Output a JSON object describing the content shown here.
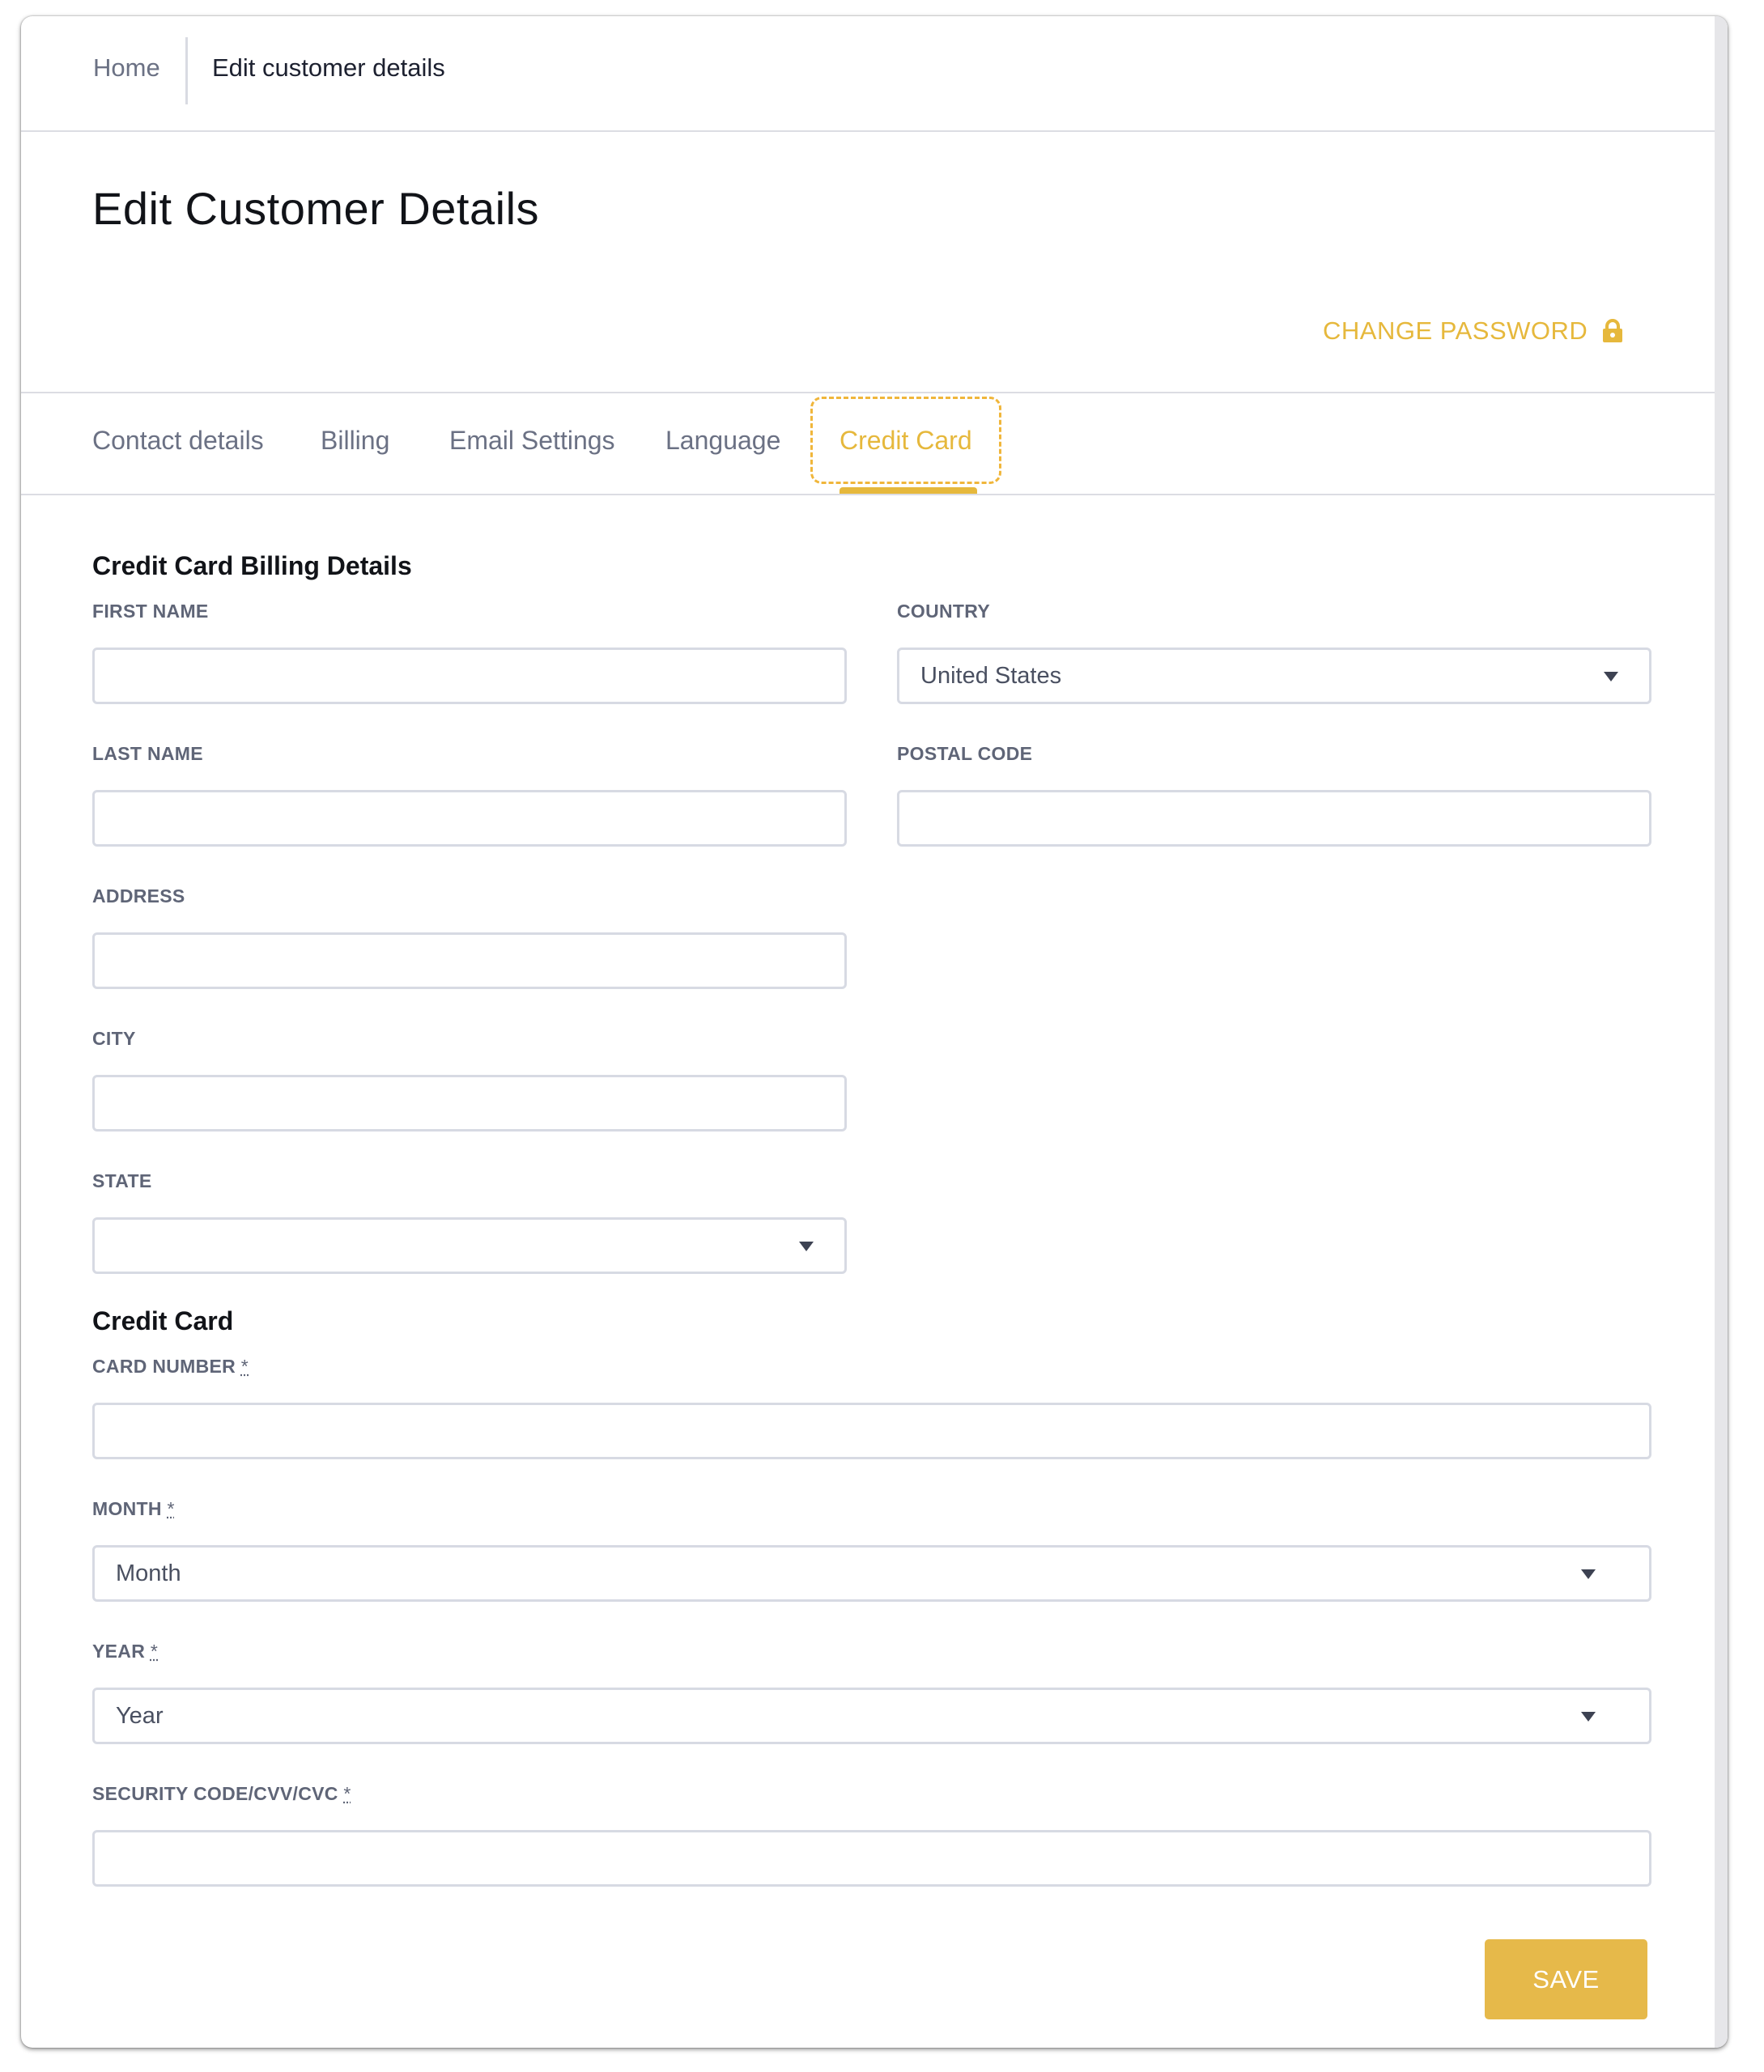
{
  "breadcrumb": {
    "home": "Home",
    "current": "Edit customer details"
  },
  "page": {
    "title": "Edit Customer Details",
    "change_password": "CHANGE PASSWORD"
  },
  "tabs": [
    {
      "label": "Contact details"
    },
    {
      "label": "Billing"
    },
    {
      "label": "Email Settings"
    },
    {
      "label": "Language"
    },
    {
      "label": "Credit Card",
      "active": true
    }
  ],
  "billing_section": {
    "title": "Credit Card Billing Details",
    "first_name_label": "FIRST NAME",
    "first_name_value": "",
    "last_name_label": "LAST NAME",
    "last_name_value": "",
    "address_label": "ADDRESS",
    "address_value": "",
    "city_label": "CITY",
    "city_value": "",
    "state_label": "STATE",
    "state_value": "",
    "country_label": "COUNTRY",
    "country_value": "United States",
    "postal_code_label": "POSTAL CODE",
    "postal_code_value": ""
  },
  "card_section": {
    "title": "Credit Card",
    "card_number_label": "CARD NUMBER",
    "card_number_value": "",
    "month_label": "MONTH",
    "month_value": "Month",
    "year_label": "YEAR",
    "year_value": "Year",
    "cvv_label": "SECURITY CODE/CVV/CVC",
    "cvv_value": "",
    "required_marker": "*"
  },
  "actions": {
    "save": "SAVE"
  },
  "icons": {
    "lock": "lock-icon",
    "caret": "chevron-down-icon"
  },
  "colors": {
    "accent": "#e6b83c",
    "label": "#5f6577",
    "border": "#d7dae3",
    "text": "#111318"
  }
}
